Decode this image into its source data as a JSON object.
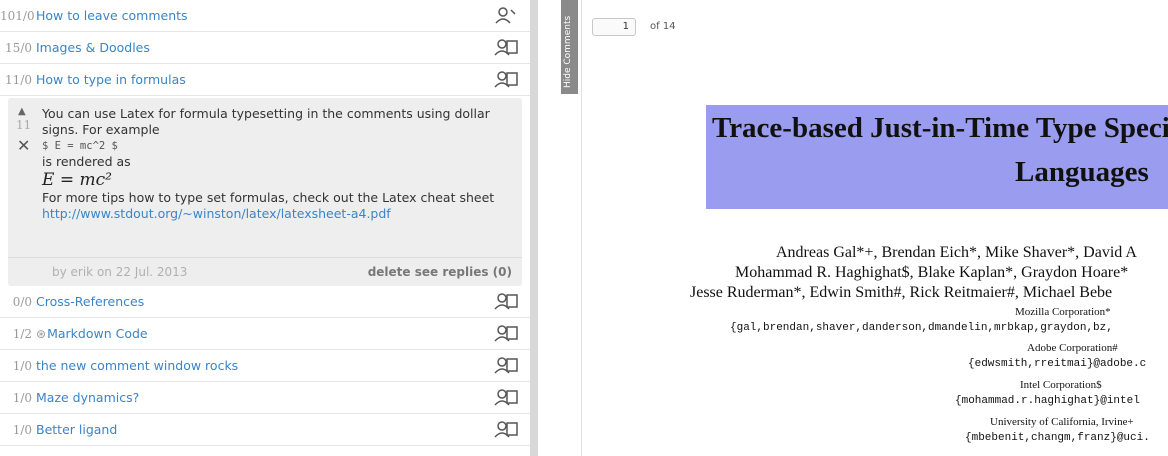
{
  "comments": [
    {
      "count": "101/0",
      "title": "How to leave comments",
      "icon": "person-pin-icon"
    },
    {
      "count": "15/0",
      "title": "Images & Doodles",
      "icon": "person-icon"
    },
    {
      "count": "11/0",
      "title": "How to type in formulas",
      "icon": "person-icon"
    }
  ],
  "expanded": {
    "votes": "11",
    "line1": "You can use Latex for formula typesetting in the comments using dollar",
    "line2": "signs. For example",
    "code": "$ E = mc^2 $",
    "rendered_as": "is rendered as",
    "math": "E = mc²",
    "more": "For more tips how to type set formulas, check out the Latex cheat sheet",
    "link": "http://www.stdout.org/~winston/latex/latexsheet-a4.pdf",
    "by": "by erik on 22 Jul. 2013",
    "delete_label": "delete",
    "replies_label": "see replies (0)"
  },
  "comments_after": [
    {
      "count": "0/0",
      "title": "Cross-References"
    },
    {
      "count": "1/2",
      "title": "Markdown Code",
      "at": true
    },
    {
      "count": "1/0",
      "title": "the new comment window rocks"
    },
    {
      "count": "1/0",
      "title": "Maze dynamics?"
    },
    {
      "count": "1/0",
      "title": "Better ligand"
    }
  ],
  "hide_comments_label": "Hide Comments",
  "pager": {
    "page": "1",
    "of": "of 14"
  },
  "paper": {
    "title_line1": "Trace-based Just-in-Time Type Speci",
    "title_line2": "Languages",
    "authors_1": "Andreas Gal*+, Brendan Eich*, Mike Shaver*, David A",
    "authors_2": "Mohammad R. Haghighat$, Blake Kaplan*, Graydon Hoare*",
    "authors_3": "Jesse Ruderman*, Edwin Smith#, Rick Reitmaier#, Michael Bebe",
    "aff_mozilla": "Mozilla Corporation*",
    "mail_mozilla": "{gal,brendan,shaver,danderson,dmandelin,mrbkap,graydon,bz,",
    "aff_adobe": "Adobe Corporation#",
    "mail_adobe": "{edwsmith,rreitmai}@adobe.c",
    "aff_intel": "Intel Corporation$",
    "mail_intel": "{mohammad.r.haghighat}@intel",
    "aff_uci": "University of California, Irvine+",
    "mail_uci": "{mbebenit,changm,franz}@uci."
  },
  "colors": {
    "link": "#3a84c9",
    "title_bg": "#9a9cf0",
    "panel_bg": "#eeeeee"
  }
}
